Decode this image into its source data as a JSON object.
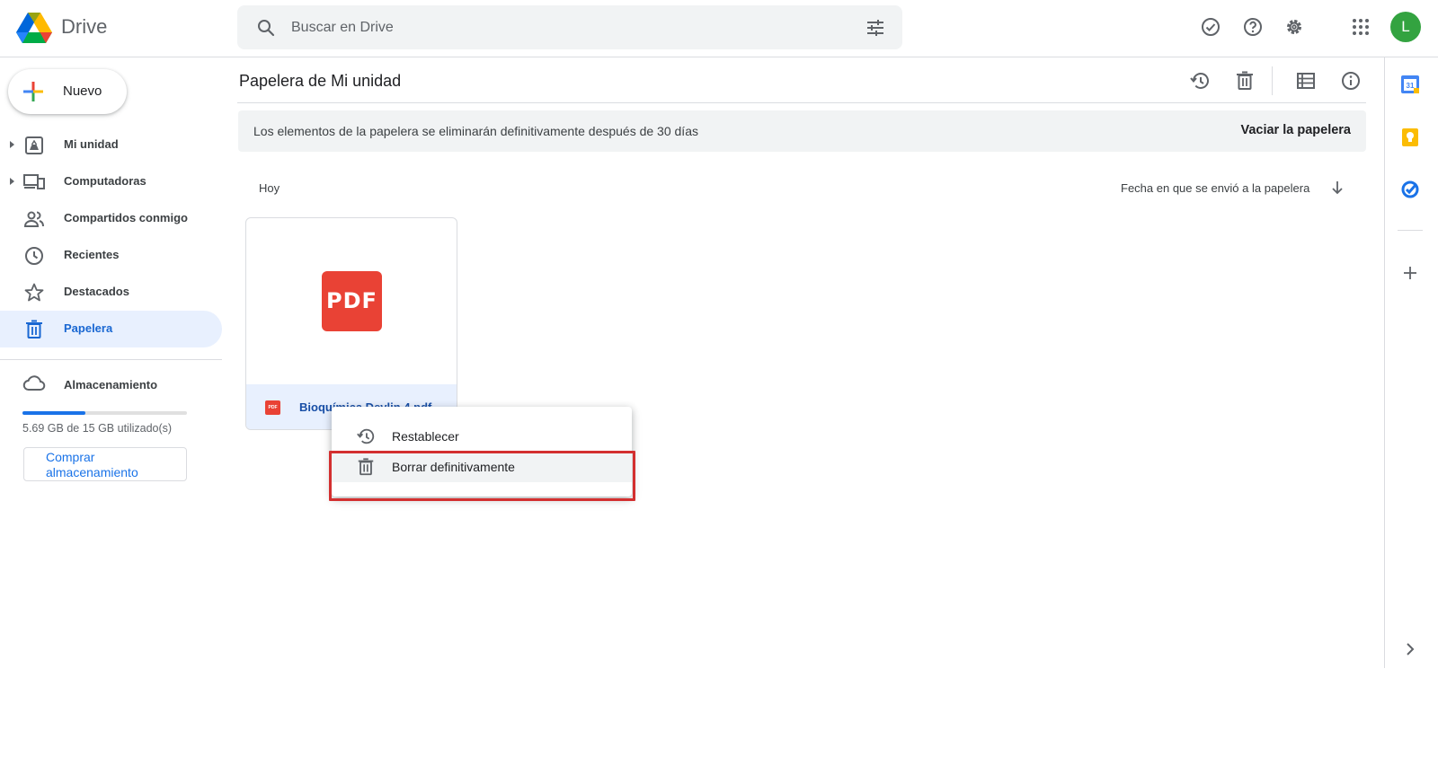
{
  "app": {
    "name": "Drive"
  },
  "search": {
    "placeholder": "Buscar en Drive"
  },
  "header": {
    "avatar_letter": "L",
    "avatar_color": "#33a340"
  },
  "sidebar": {
    "new_label": "Nuevo",
    "items": [
      {
        "label": "Mi unidad",
        "icon": "my-drive-icon"
      },
      {
        "label": "Computadoras",
        "icon": "computers-icon"
      },
      {
        "label": "Compartidos conmigo",
        "icon": "shared-icon"
      },
      {
        "label": "Recientes",
        "icon": "clock-icon"
      },
      {
        "label": "Destacados",
        "icon": "star-icon"
      },
      {
        "label": "Papelera",
        "icon": "trash-icon",
        "active": true
      }
    ],
    "storage": {
      "label": "Almacenamiento",
      "used_text": "5.69 GB de 15 GB utilizado(s)",
      "used_fraction": 0.38,
      "buy_label": "Comprar almacenamiento"
    }
  },
  "main": {
    "title": "Papelera de Mi unidad",
    "banner": {
      "message": "Los elementos de la papelera se eliminarán definitivamente después de 30 días",
      "action": "Vaciar la papelera"
    },
    "section": "Hoy",
    "sort_label": "Fecha en que se envió a la papelera",
    "files": [
      {
        "name": "Bioquímica Devlin 4.pdf",
        "thumb_label": "PDF",
        "icon_label": "PDF"
      }
    ]
  },
  "context_menu": {
    "items": [
      {
        "label": "Restablecer",
        "icon": "restore-icon"
      },
      {
        "label": "Borrar definitivamente",
        "icon": "trash-icon"
      }
    ]
  },
  "colors": {
    "accent": "#1a73e8",
    "active_bg": "#e8f0fe",
    "pdf_red": "#e94235",
    "highlight": "#d32f2f"
  }
}
